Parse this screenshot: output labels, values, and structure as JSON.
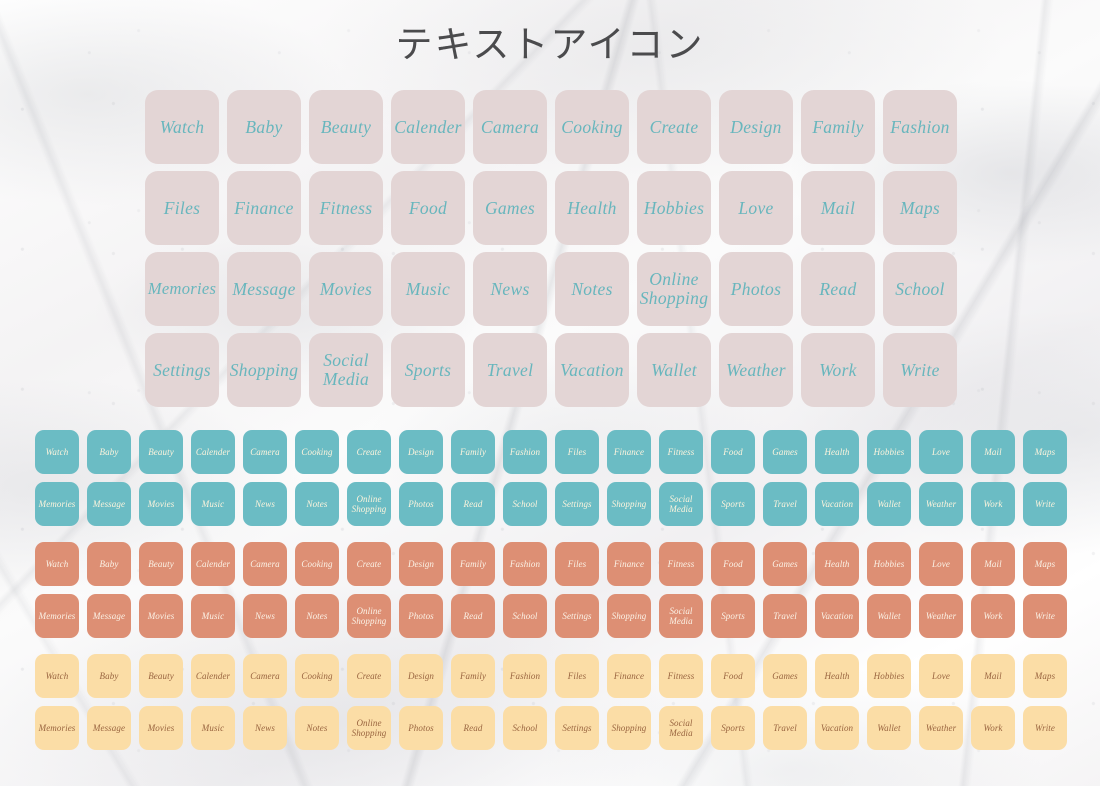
{
  "title": "テキストアイコン",
  "colors": {
    "background": "#f6f5f5",
    "pink_tile": "#e3d5d5",
    "pink_text": "#68b6bd",
    "teal_tile": "#6bbcc4",
    "teal_text": "#fdf4dd",
    "terracotta_tile": "#dd8f74",
    "terracotta_text": "#fbf2e6",
    "cream_tile": "#fbdda6",
    "cream_text": "#9a6540",
    "title_text": "#4b4b4d"
  },
  "labels": {
    "watch": "Watch",
    "baby": "Baby",
    "beauty": "Beauty",
    "calender": "Calender",
    "camera": "Camera",
    "cooking": "Cooking",
    "create": "Create",
    "design": "Design",
    "family": "Family",
    "fashion": "Fashion",
    "files": "Files",
    "finance": "Finance",
    "fitness": "Fitness",
    "food": "Food",
    "games": "Games",
    "health": "Health",
    "hobbies": "Hobbies",
    "love": "Love",
    "mail": "Mail",
    "maps": "Maps",
    "memories": "Memories",
    "message": "Message",
    "movies": "Movies",
    "music": "Music",
    "news": "News",
    "notes": "Notes",
    "online_shopping": "Online\nShopping",
    "photos": "Photos",
    "read": "Read",
    "school": "School",
    "settings": "Settings",
    "shopping": "Shopping",
    "social_media": "Social\nMedia",
    "sports": "Sports",
    "travel": "Travel",
    "vacation": "Vacation",
    "wallet": "Wallet",
    "weather": "Weather",
    "work": "Work",
    "write": "Write"
  },
  "icon_order": [
    "Watch",
    "Baby",
    "Beauty",
    "Calender",
    "Camera",
    "Cooking",
    "Create",
    "Design",
    "Family",
    "Fashion",
    "Files",
    "Finance",
    "Fitness",
    "Food",
    "Games",
    "Health",
    "Hobbies",
    "Love",
    "Mail",
    "Maps",
    "Memories",
    "Message",
    "Movies",
    "Music",
    "News",
    "Notes",
    "Online\nShopping",
    "Photos",
    "Read",
    "School",
    "Settings",
    "Shopping",
    "Social\nMedia",
    "Sports",
    "Travel",
    "Vacation",
    "Wallet",
    "Weather",
    "Work",
    "Write"
  ],
  "sets": [
    {
      "id": "pink",
      "name": "large-pink-icon-set",
      "tile_color": "#e3d5d5",
      "text_color": "#68b6bd",
      "columns": 10,
      "rows": 4,
      "count": 40
    },
    {
      "id": "teal",
      "name": "small-teal-icon-set",
      "tile_color": "#6bbcc4",
      "text_color": "#fdf4dd",
      "columns": 20,
      "rows": 2,
      "count": 40
    },
    {
      "id": "terracotta",
      "name": "small-terracotta-icon-set",
      "tile_color": "#dd8f74",
      "text_color": "#fbf2e6",
      "columns": 20,
      "rows": 2,
      "count": 40
    },
    {
      "id": "cream",
      "name": "small-cream-icon-set",
      "tile_color": "#fbdda6",
      "text_color": "#9a6540",
      "columns": 20,
      "rows": 2,
      "count": 40
    }
  ]
}
